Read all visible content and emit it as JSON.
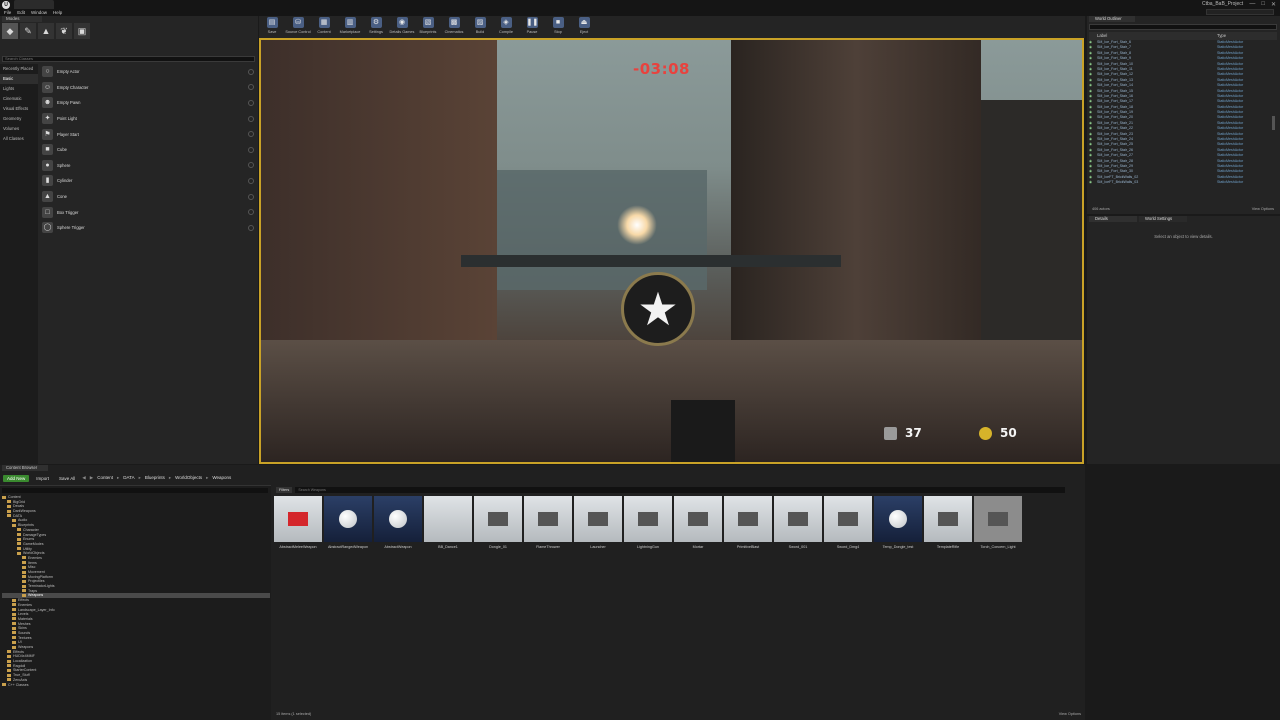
{
  "window": {
    "project_name": "Ctba_BaB_Project",
    "logo_glyph": "U",
    "controls": [
      "—",
      "□",
      "✕"
    ]
  },
  "menu": [
    "File",
    "Edit",
    "Window",
    "Help"
  ],
  "modes": {
    "tab_label": "Modes",
    "icons": [
      {
        "name": "place-mode-icon",
        "glyph": "◆"
      },
      {
        "name": "paint-mode-icon",
        "glyph": "✎"
      },
      {
        "name": "landscape-mode-icon",
        "glyph": "▲"
      },
      {
        "name": "foliage-mode-icon",
        "glyph": "❦"
      },
      {
        "name": "geometry-mode-icon",
        "glyph": "▣"
      }
    ],
    "search_placeholder": "Search Classes",
    "categories": [
      "Recently Placed",
      "Basic",
      "Lights",
      "Cinematic",
      "Visual Effects",
      "Geometry",
      "Volumes",
      "All Classes"
    ],
    "active_category": "Basic",
    "items": [
      {
        "label": "Empty Actor",
        "glyph": "○"
      },
      {
        "label": "Empty Character",
        "glyph": "☺"
      },
      {
        "label": "Empty Pawn",
        "glyph": "☻"
      },
      {
        "label": "Point Light",
        "glyph": "✦"
      },
      {
        "label": "Player Start",
        "glyph": "⚑"
      },
      {
        "label": "Cube",
        "glyph": "■"
      },
      {
        "label": "Sphere",
        "glyph": "●"
      },
      {
        "label": "Cylinder",
        "glyph": "▮"
      },
      {
        "label": "Cone",
        "glyph": "▲"
      },
      {
        "label": "Box Trigger",
        "glyph": "□"
      },
      {
        "label": "Sphere Trigger",
        "glyph": "◯"
      }
    ]
  },
  "toolbar": [
    {
      "label": "Save",
      "glyph": "▤"
    },
    {
      "label": "Source Control",
      "glyph": "⛁"
    },
    {
      "label": "Content",
      "glyph": "▦"
    },
    {
      "label": "Marketplace",
      "glyph": "▥"
    },
    {
      "label": "Settings",
      "glyph": "⚙"
    },
    {
      "label": "Details Games",
      "glyph": "◉"
    },
    {
      "label": "Blueprints",
      "glyph": "▧"
    },
    {
      "label": "Cinematics",
      "glyph": "▩"
    },
    {
      "label": "Build",
      "glyph": "▨"
    },
    {
      "label": "Compile",
      "glyph": "◈"
    },
    {
      "label": "Pause",
      "glyph": "❚❚"
    },
    {
      "label": "Stop",
      "glyph": "■"
    },
    {
      "label": "Eject",
      "glyph": "⏏"
    }
  ],
  "viewport": {
    "timer": "-03:08",
    "ammo": "37",
    "coins": "50",
    "crosshair_glyph": "★"
  },
  "outliner": {
    "tab_label": "World Outliner",
    "columns": [
      "Label",
      "Type"
    ],
    "rows": [
      "SM_Ice_Fort_Stair_6",
      "SM_Ice_Fort_Stair_7",
      "SM_Ice_Fort_Stair_8",
      "SM_Ice_Fort_Stair_9",
      "SM_Ice_Fort_Stair_10",
      "SM_Ice_Fort_Stair_11",
      "SM_Ice_Fort_Stair_12",
      "SM_Ice_Fort_Stair_13",
      "SM_Ice_Fort_Stair_14",
      "SM_Ice_Fort_Stair_15",
      "SM_Ice_Fort_Stair_16",
      "SM_Ice_Fort_Stair_17",
      "SM_Ice_Fort_Stair_18",
      "SM_Ice_Fort_Stair_19",
      "SM_Ice_Fort_Stair_20",
      "SM_Ice_Fort_Stair_21",
      "SM_Ice_Fort_Stair_22",
      "SM_Ice_Fort_Stair_23",
      "SM_Ice_Fort_Stair_24",
      "SM_Ice_Fort_Stair_25",
      "SM_Ice_Fort_Stair_26",
      "SM_Ice_Fort_Stair_27",
      "SM_Ice_Fort_Stair_28",
      "SM_Ice_Fort_Stair_29",
      "SM_Ice_Fort_Stair_30",
      "SM_IceFT_BrickWalls_02",
      "SM_IceFT_BrickWalls_03"
    ],
    "row_type": "StaticMeshActor",
    "actor_count": "406 actors",
    "view_options": "View Options"
  },
  "details": {
    "tab_details": "Details",
    "tab_world_settings": "World Settings",
    "empty_message": "Select an object to view details."
  },
  "content_browser": {
    "tab_label": "Content Browser",
    "add_new": "Add New",
    "import": "Import",
    "save_all": "Save All",
    "breadcrumbs": [
      "Content",
      "DATA",
      "Blueprints",
      "WorldObjects",
      "Weapons"
    ],
    "filters": "Filters",
    "search_placeholder": "Search Weapons",
    "tree": [
      {
        "label": "Content",
        "depth": 0
      },
      {
        "label": "BigGrid",
        "depth": 1
      },
      {
        "label": "Decals",
        "depth": 1
      },
      {
        "label": "DarkWeapons",
        "depth": 1
      },
      {
        "label": "DATA",
        "depth": 1
      },
      {
        "label": "Audio",
        "depth": 2
      },
      {
        "label": "Blueprints",
        "depth": 2
      },
      {
        "label": "Character",
        "depth": 3
      },
      {
        "label": "DamageTypes",
        "depth": 3
      },
      {
        "label": "Enums",
        "depth": 3
      },
      {
        "label": "GameModes",
        "depth": 3
      },
      {
        "label": "Utility",
        "depth": 3
      },
      {
        "label": "WorldObjects",
        "depth": 3
      },
      {
        "label": "Enemies",
        "depth": 4
      },
      {
        "label": "Items",
        "depth": 4
      },
      {
        "label": "Misc",
        "depth": 4
      },
      {
        "label": "Movement",
        "depth": 4
      },
      {
        "label": "MovingPlatform",
        "depth": 4
      },
      {
        "label": "Projectiles",
        "depth": 4
      },
      {
        "label": "TerminatorLights",
        "depth": 4
      },
      {
        "label": "Traps",
        "depth": 4
      },
      {
        "label": "Weapons",
        "depth": 4,
        "selected": true
      },
      {
        "label": "Effects",
        "depth": 2
      },
      {
        "label": "Enemies",
        "depth": 2
      },
      {
        "label": "Landscape_Layer_Info",
        "depth": 2
      },
      {
        "label": "Levels",
        "depth": 2
      },
      {
        "label": "Materials",
        "depth": 2
      },
      {
        "label": "Meshes",
        "depth": 2
      },
      {
        "label": "Skins",
        "depth": 2
      },
      {
        "label": "Sounds",
        "depth": 2
      },
      {
        "label": "Textures",
        "depth": 2
      },
      {
        "label": "UI",
        "depth": 2
      },
      {
        "label": "Weapons",
        "depth": 2
      },
      {
        "label": "Effects",
        "depth": 1
      },
      {
        "label": "HUD4x4MMF",
        "depth": 1
      },
      {
        "label": "Localization",
        "depth": 1
      },
      {
        "label": "Ragdoll",
        "depth": 1
      },
      {
        "label": "StarterContent",
        "depth": 1
      },
      {
        "label": "True_Stuff",
        "depth": 1
      },
      {
        "label": "ZeroAxis",
        "depth": 1
      },
      {
        "label": "C++ Classes",
        "depth": 0
      }
    ],
    "assets": [
      {
        "label": "AbstractMeleeWeapon",
        "thumb": "red"
      },
      {
        "label": "AbstractRangedWeapon",
        "thumb": "sphere-blue"
      },
      {
        "label": "AbstractWeapon",
        "thumb": "sphere-blue"
      },
      {
        "label": "BB_Dance1",
        "thumb": "plain"
      },
      {
        "label": "Dongle_01",
        "thumb": "obj"
      },
      {
        "label": "FlameThrower",
        "thumb": "obj"
      },
      {
        "label": "Launcher",
        "thumb": "obj"
      },
      {
        "label": "LightningGun",
        "thumb": "obj"
      },
      {
        "label": "Mortar",
        "thumb": "obj"
      },
      {
        "label": "PrimitiveBlast",
        "thumb": "obj"
      },
      {
        "label": "Sword_001",
        "thumb": "obj"
      },
      {
        "label": "Sword_Dmg4",
        "thumb": "obj"
      },
      {
        "label": "Temp_Dongle_test",
        "thumb": "sphere-blue"
      },
      {
        "label": "TemplateRifle",
        "thumb": "obj"
      },
      {
        "label": "Torch_Concern_Light",
        "thumb": "selected"
      }
    ],
    "item_count": "15 items (1 selected)",
    "view_options": "View Options"
  }
}
